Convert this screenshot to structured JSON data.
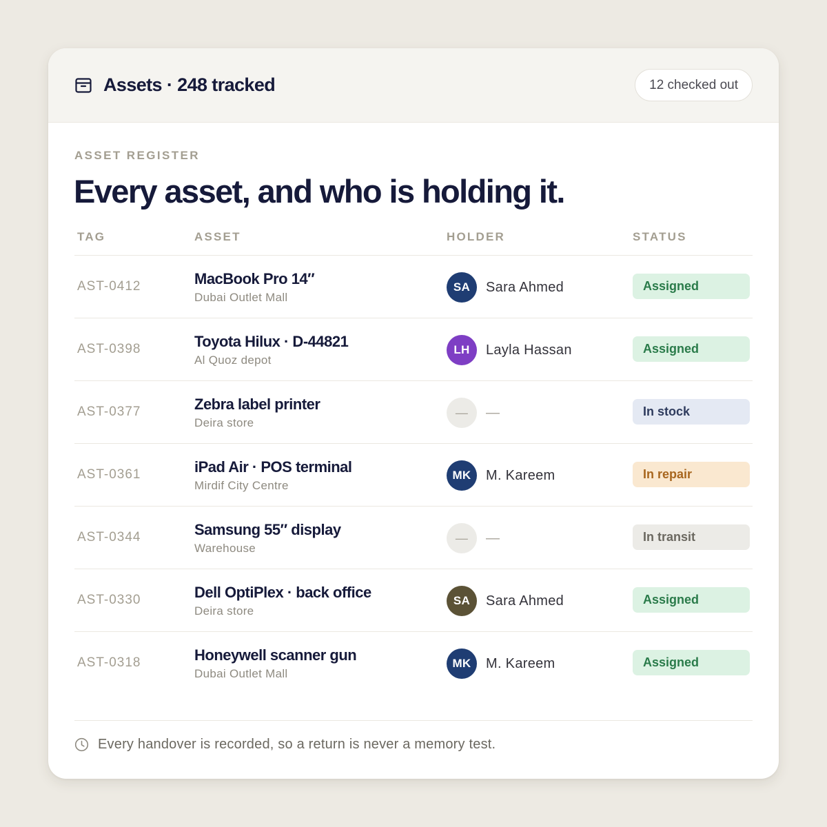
{
  "header": {
    "icon": "archive-box-icon",
    "title": "Assets · 248 tracked",
    "checked_out": "12 checked out"
  },
  "intro": {
    "eyebrow": "ASSET REGISTER",
    "headline": "Every asset, and who is holding it."
  },
  "table": {
    "columns": [
      "TAG",
      "ASSET",
      "HOLDER",
      "STATUS"
    ],
    "rows": [
      {
        "tag": "AST-0412",
        "asset": "MacBook Pro 14″",
        "location": "Dubai Outlet Mall",
        "initials": "SA",
        "holder": "Sara Ahmed",
        "avatar_color": "#1f3d73",
        "status": "Assigned",
        "status_bg": "#dcf2e3",
        "status_fg": "#2a7b4a"
      },
      {
        "tag": "AST-0398",
        "asset": "Toyota Hilux · D-44821",
        "location": "Al Quoz depot",
        "initials": "LH",
        "holder": "Layla Hassan",
        "avatar_color": "#7e3ec4",
        "status": "Assigned",
        "status_bg": "#dcf2e3",
        "status_fg": "#2a7b4a"
      },
      {
        "tag": "AST-0377",
        "asset": "Zebra label printer",
        "location": "Deira store",
        "initials": "—",
        "holder": "—",
        "avatar_color": "#ecebe7",
        "status": "In stock",
        "status_bg": "#e4e9f3",
        "status_fg": "#2f3c5e"
      },
      {
        "tag": "AST-0361",
        "asset": "iPad Air · POS terminal",
        "location": "Mirdif City Centre",
        "initials": "MK",
        "holder": "M. Kareem",
        "avatar_color": "#1f3d73",
        "status": "In repair",
        "status_bg": "#fae8d0",
        "status_fg": "#a8661e"
      },
      {
        "tag": "AST-0344",
        "asset": "Samsung 55″ display",
        "location": "Warehouse",
        "initials": "—",
        "holder": "—",
        "avatar_color": "#ecebe7",
        "status": "In transit",
        "status_bg": "#ecebe7",
        "status_fg": "#6b6860"
      },
      {
        "tag": "AST-0330",
        "asset": "Dell OptiPlex · back office",
        "location": "Deira store",
        "initials": "SA",
        "holder": "Sara Ahmed",
        "avatar_color": "#5b5236",
        "status": "Assigned",
        "status_bg": "#dcf2e3",
        "status_fg": "#2a7b4a"
      },
      {
        "tag": "AST-0318",
        "asset": "Honeywell scanner gun",
        "location": "Dubai Outlet Mall",
        "initials": "MK",
        "holder": "M. Kareem",
        "avatar_color": "#1f3d73",
        "status": "Assigned",
        "status_bg": "#dcf2e3",
        "status_fg": "#2a7b4a"
      }
    ]
  },
  "footer": {
    "icon": "clock-icon",
    "text": "Every handover is recorded, so a return is never a memory test."
  }
}
